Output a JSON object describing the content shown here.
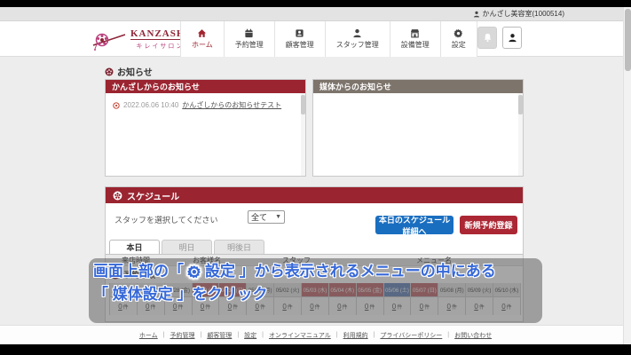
{
  "chrome": {
    "user_label": "かんざし美容室(1000514)"
  },
  "nav": {
    "logo_title": "KANZASHI",
    "logo_subtitle": "キレイサロン",
    "items": [
      {
        "label": "ホーム",
        "icon": "home-icon",
        "active": true
      },
      {
        "label": "予約管理",
        "icon": "calendar-icon",
        "active": false
      },
      {
        "label": "顧客管理",
        "icon": "id-card-icon",
        "active": false
      },
      {
        "label": "スタッフ管理",
        "icon": "person-icon",
        "active": false
      },
      {
        "label": "設備管理",
        "icon": "building-icon",
        "active": false
      },
      {
        "label": "設定",
        "icon": "gear-icon",
        "active": false
      }
    ]
  },
  "notices": {
    "section_title": "お知らせ",
    "kanzashi_card": {
      "title": "かんざしからのお知らせ",
      "item": {
        "date": "2022.06.06 10:40",
        "link_text": "かんざしからのお知らせテスト"
      }
    },
    "media_card": {
      "title": "媒体からのお知らせ"
    }
  },
  "schedule": {
    "section_title": "スケジュール",
    "staff_filter_label": "スタッフを選択してください",
    "staff_filter_value": "全て",
    "today_detail_button": "本日のスケジュール詳細へ",
    "new_reservation_button": "新規予約登録",
    "tabs": [
      {
        "label": "本日",
        "active": true
      },
      {
        "label": "明日",
        "active": false
      },
      {
        "label": "明後日",
        "active": false
      }
    ],
    "table_headers": {
      "time": "来店時間",
      "customer": "お客様名",
      "staff": "スタッフ",
      "menu": "メニュー名"
    },
    "counts_section_title": "予約件数"
  },
  "reservation_counts": {
    "days": [
      {
        "date": "04/26 (水)",
        "type": "normal",
        "count_value": "0",
        "count_unit": "件"
      },
      {
        "date": "04/27 (木)",
        "type": "normal",
        "count_value": "0",
        "count_unit": "件"
      },
      {
        "date": "04/28 (金)",
        "type": "normal",
        "count_value": "0",
        "count_unit": "件"
      },
      {
        "date": "04/29 (土)",
        "type": "holiday",
        "count_value": "0",
        "count_unit": "件"
      },
      {
        "date": "04/30 (日)",
        "type": "holiday",
        "count_value": "0",
        "count_unit": "件"
      },
      {
        "date": "05/01 (月)",
        "type": "normal",
        "count_value": "0",
        "count_unit": "件"
      },
      {
        "date": "05/02 (火)",
        "type": "normal",
        "count_value": "0",
        "count_unit": "件"
      },
      {
        "date": "05/03 (水)",
        "type": "holiday",
        "count_value": "0",
        "count_unit": "件"
      },
      {
        "date": "05/04 (木)",
        "type": "holiday",
        "count_value": "0",
        "count_unit": "件"
      },
      {
        "date": "05/05 (金)",
        "type": "holiday",
        "count_value": "0",
        "count_unit": "件"
      },
      {
        "date": "05/06 (土)",
        "type": "saturday",
        "count_value": "0",
        "count_unit": "件"
      },
      {
        "date": "05/07 (日)",
        "type": "holiday",
        "count_value": "0",
        "count_unit": "件"
      },
      {
        "date": "05/08 (月)",
        "type": "normal",
        "count_value": "0",
        "count_unit": "件"
      },
      {
        "date": "05/09 (火)",
        "type": "normal",
        "count_value": "0",
        "count_unit": "件"
      },
      {
        "date": "05/10 (水)",
        "type": "normal",
        "count_value": "0",
        "count_unit": "件"
      }
    ]
  },
  "overlay": {
    "line1_pre": "画面上部の「",
    "line1_post": "設定 」から表示されるメニューの中にある",
    "line2": "「 媒体設定 」をクリック",
    "text_color": "#3668d8"
  },
  "footer": {
    "links": [
      "ホーム",
      "予約管理",
      "顧客管理",
      "設定",
      "オンラインマニュアル",
      "利用規約",
      "プライバシーポリシー",
      "お問い合わせ"
    ]
  },
  "colors": {
    "brand_dark_red": "#9a2430",
    "media_header_gray": "#7d746c",
    "primary_blue_button": "#1a6ec0",
    "primary_red_button": "#ab2733",
    "holiday_cell": "#bb5a5f",
    "saturday_cell": "#5579b4"
  }
}
